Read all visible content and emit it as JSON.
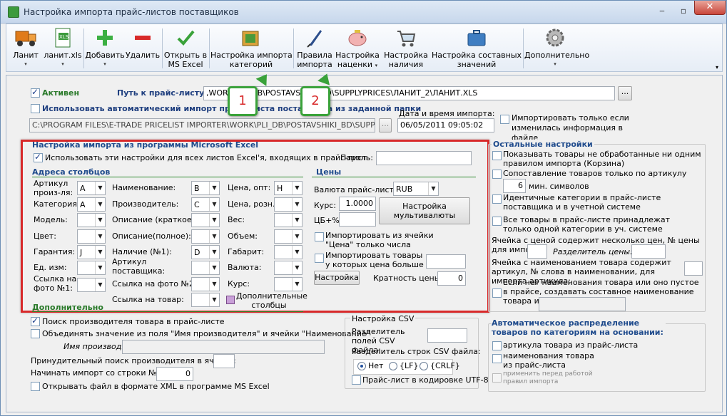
{
  "window": {
    "title": "Настройка импорта прайс-листов поставщиков",
    "minimize": "‒",
    "maximize": "▫",
    "close": "✕"
  },
  "toolbar": {
    "items": [
      {
        "label": "Ланит",
        "arrow": "▾",
        "icon": "truck-icon"
      },
      {
        "label": "ланит.xls",
        "arrow": "▾",
        "icon": "excel-file-icon"
      },
      {
        "label": "Добавить",
        "arrow": "▾",
        "icon": "plus-icon"
      },
      {
        "label": "Удалить",
        "icon": "minus-icon"
      },
      {
        "label": "Открыть в\nMS Excel",
        "icon": "checkmark-icon"
      },
      {
        "label": "Настройка импорта\nкатегорий",
        "icon": "categories-icon"
      },
      {
        "label": "Правила\nимпорта",
        "icon": "quill-icon"
      },
      {
        "label": "Настройка\nнаценки",
        "arrow": "▾",
        "icon": "piggy-bank-icon"
      },
      {
        "label": "Настройка\nналичия",
        "icon": "cart-icon"
      },
      {
        "label": "Настройка составных\nзначений",
        "icon": "briefcase-icon"
      },
      {
        "label": "Дополнительно",
        "arrow": "▾",
        "icon": "gear-icon"
      }
    ]
  },
  "callouts": [
    "1",
    "2"
  ],
  "top": {
    "active_label": "Активен",
    "path_label": "Путь к прайс-листу:",
    "path_value": ",WORK\\PLI_DB\\POSTAVSHIKI_BD\\SUPPLYPRICES\\ЛАНИТ_2\\ЛАНИТ.XLS",
    "browse": "...",
    "auto_import_label": "Использовать автоматический импорт прайс-листа поставщика из заданной папки",
    "folder_value": "C:\\PROGRAM FILES\\E-TRADE PRICELIST IMPORTER\\WORK\\PLI_DB\\POSTAVSHIKI_BD\\SUPPLYPRIC",
    "folder_browse": "...",
    "datetime_label": "Дата и время импорта:",
    "datetime_value": "06/05/2011 09:05:02",
    "import_if_changed": "Импортировать только если изменилась информация в файле"
  },
  "excel": {
    "title": "Настройка импорта из программы Microsoft Excel",
    "use_all_sheets": "Использовать эти настройки для всех листов Excel'я, входящих в прайс-лист",
    "password_label": "Пароль:",
    "columns_title": "Адреса столбцов",
    "prices_title": "Цены",
    "fields": [
      {
        "label": "Артикул произ-ля:",
        "value": "A"
      },
      {
        "label": "Категория:",
        "value": "A"
      },
      {
        "label": "Модель:",
        "value": ""
      },
      {
        "label": "Цвет:",
        "value": ""
      },
      {
        "label": "Гарантия:",
        "value": "J"
      },
      {
        "label": "Ед. изм:",
        "value": ""
      },
      {
        "label": "Ссылка на фото №1:",
        "value": ""
      }
    ],
    "fields2": [
      {
        "label": "Наименование:",
        "value": "B"
      },
      {
        "label": "Производитель:",
        "value": "C"
      },
      {
        "label": "Описание (краткое):",
        "value": ""
      },
      {
        "label": "Описание(полное):",
        "value": ""
      },
      {
        "label": "Наличие (№1):",
        "value": "D"
      },
      {
        "label": "Артикул поставщика:",
        "value": ""
      },
      {
        "label": "Ссылка на фото №2:",
        "value": ""
      },
      {
        "label": "Ссылка на товар:",
        "value": ""
      }
    ],
    "fields3": [
      {
        "label": "Цена, опт:",
        "value": "H"
      },
      {
        "label": "Цена, розн.:",
        "value": ""
      },
      {
        "label": "Вес:",
        "value": ""
      },
      {
        "label": "Объем:",
        "value": ""
      },
      {
        "label": "Габарит:",
        "value": ""
      },
      {
        "label": "Валюта:",
        "value": ""
      },
      {
        "label": "Курс:",
        "value": ""
      }
    ],
    "extra_columns": "Дополнительные столбцы",
    "currency_label": "Валюта прайс-листа:",
    "currency_value": "RUB",
    "rate_label": "Курс:",
    "rate_value": "1.0000",
    "cb_label": "ЦБ+%",
    "cb_value": "",
    "multicurrency": "Настройка мультивалюты",
    "import_from_price_cell": "Импортировать из ячейки \"Цена\" только числа",
    "import_price_greater": "Импортировать товары у которых цена больше чем:",
    "settings_button": "Настройка",
    "price_multiple_label": "Кратность цены:",
    "price_multiple_value": "0",
    "additional_title": "Дополнительно"
  },
  "bottom": {
    "search_manufacturer": "Поиск производителя товара в прайс-листе",
    "merge_values": "Объединять значение из поля \"Имя производителя\" и ячейки \"Наименование\"",
    "manufacturer_name_label": "Имя производителя:",
    "forced_search_label": "Принудительный поиск производителя в ячейке:",
    "start_row_label": "Начинать импорт со строки №:",
    "start_row_value": "0",
    "open_xml": "Открывать файл в формате XML в программе MS Excel"
  },
  "csv": {
    "title": "Настройка CSV",
    "field_sep_label": "Разделитель полей CSV файла:",
    "row_sep_label": "Разделитель строк CSV файла:",
    "opt_none": "Нет",
    "opt_lf": "{LF}",
    "opt_crlf": "{CRLF}",
    "utf8": "Прайс-лист в кодировке UTF-8"
  },
  "other": {
    "title": "Остальные настройки",
    "show_unprocessed": "Показывать товары не обработанные ни одним правилом импорта (Корзина)",
    "match_by_article": "Сопоставление товаров только по артикулу",
    "min_chars_value": "6",
    "min_chars_label": "мин. символов",
    "identical_categories": "Идентичные категории в прайс-листе поставщика и в учетной системе",
    "all_in_one_category": "Все товары в прайс-листе принадлежат только одной категории в уч. системе",
    "multi_price_label": "Ячейка с ценой содержит несколько цен, № цены для импорта:",
    "price_separator_label": "Разделитель цены:",
    "article_in_name_label": "Ячейка с наименованием товара содержит артикул, № слова в наименовании, для импорта артикула:",
    "composite_name": "Если нет наименования товара или оно пустое в прайсе, создавать составное наименование товара из ячеек:"
  },
  "auto_dist": {
    "title": "Автоматическое распределение товаров по категориям на основании:",
    "by_article": "артикула товара из прайс-листа",
    "by_name": "наименования товара из прайс-листа",
    "apply_before": "применить перед работой правил импорта"
  }
}
